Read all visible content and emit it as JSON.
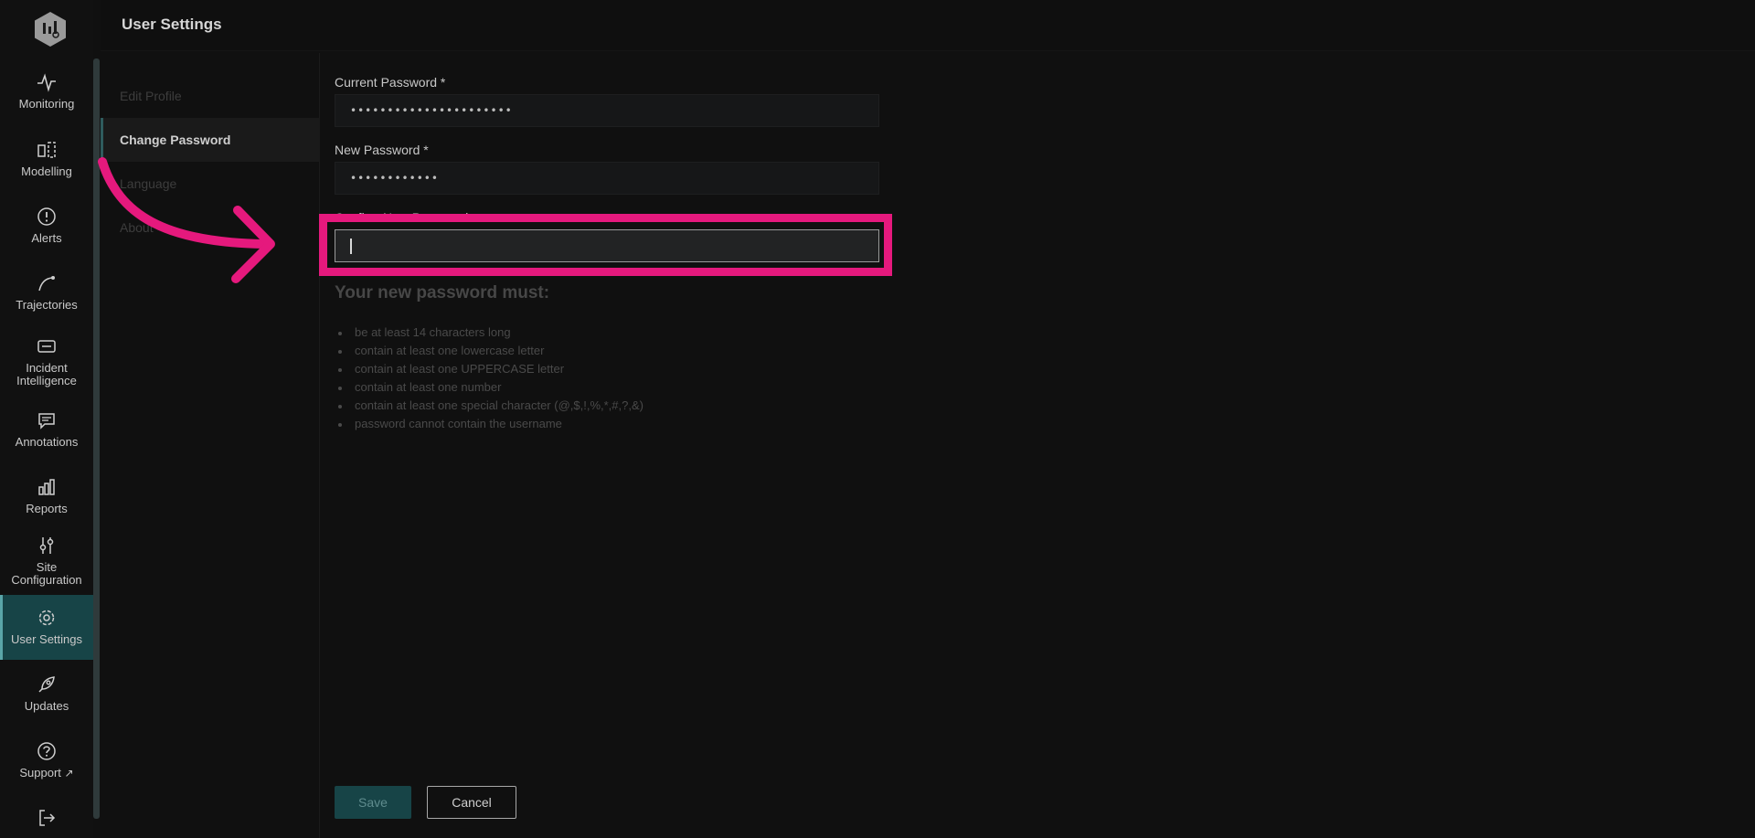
{
  "app": {
    "title": "User Settings"
  },
  "nav": {
    "items": [
      {
        "label": "Monitoring",
        "icon": "pulse-icon"
      },
      {
        "label": "Modelling",
        "icon": "modelling-icon"
      },
      {
        "label": "Alerts",
        "icon": "alert-circle-icon"
      },
      {
        "label": "Trajectories",
        "icon": "trajectory-icon"
      },
      {
        "label": "Incident\nIntelligence",
        "icon": "ticket-icon"
      },
      {
        "label": "Annotations",
        "icon": "comment-icon"
      },
      {
        "label": "Reports",
        "icon": "bar-chart-icon"
      },
      {
        "label": "Site\nConfiguration",
        "icon": "sliders-icon"
      },
      {
        "label": "User Settings",
        "icon": "gear-icon",
        "active": true
      },
      {
        "label": "Updates",
        "icon": "rocket-icon"
      },
      {
        "label": "Support",
        "icon": "help-circle-icon"
      },
      {
        "label": "",
        "icon": "logout-icon"
      }
    ]
  },
  "subnav": {
    "items": [
      {
        "label": "Edit Profile"
      },
      {
        "label": "Change Password",
        "active": true
      },
      {
        "label": "Language"
      },
      {
        "label": "About"
      }
    ]
  },
  "form": {
    "current_password": {
      "label": "Current Password *",
      "value": "••••••••••••••••••••••"
    },
    "new_password": {
      "label": "New Password *",
      "value": "••••••••••••"
    },
    "confirm_password": {
      "label": "Confirm New Password",
      "value": ""
    }
  },
  "rules": {
    "title": "Your new password must:",
    "items": [
      "be at least 14 characters long",
      "contain at least one lowercase letter",
      "contain at least one UPPERCASE letter",
      "contain at least one number",
      "contain at least one special character (@,$,!,%,*,#,?,&)",
      "password cannot contain the username"
    ]
  },
  "actions": {
    "save_label": "Save",
    "cancel_label": "Cancel"
  },
  "colors": {
    "accent": "#174447",
    "annotation": "#e5197d",
    "background": "#101010"
  }
}
